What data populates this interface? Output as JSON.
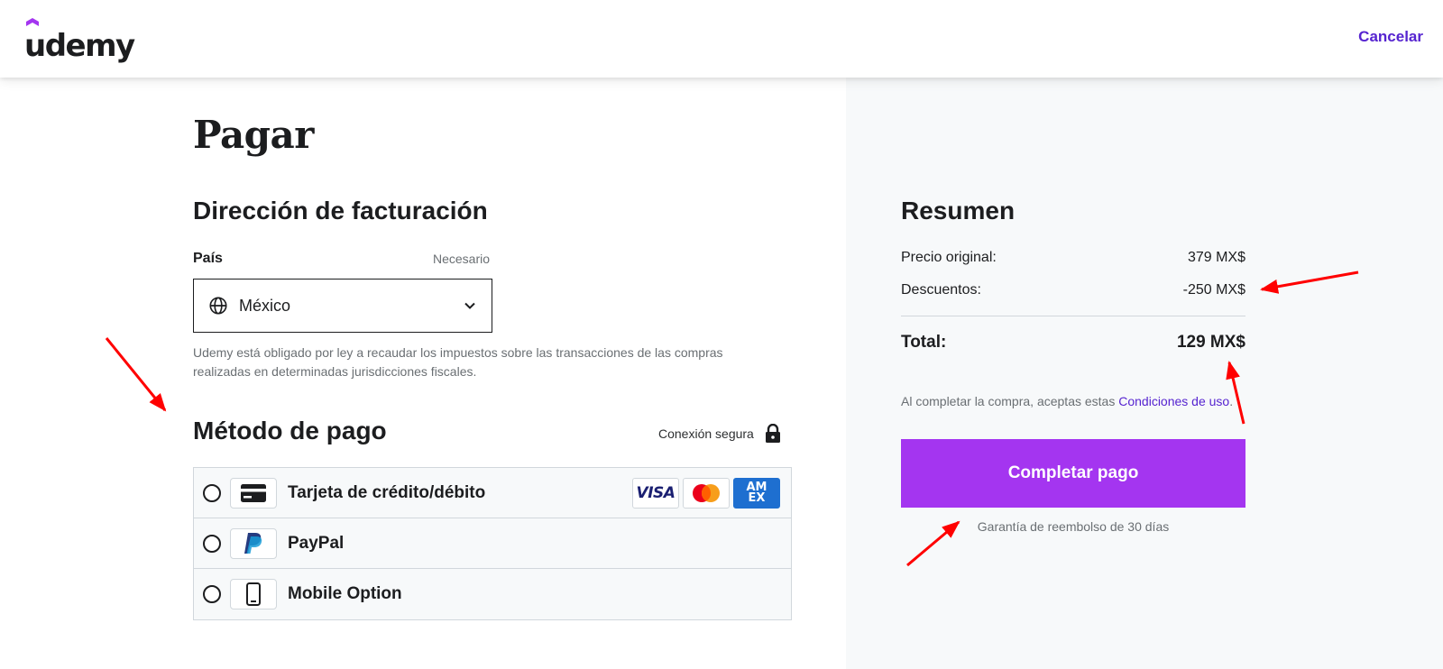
{
  "header": {
    "logo_text": "udemy",
    "cancel_label": "Cancelar"
  },
  "checkout": {
    "title": "Pagar"
  },
  "billing": {
    "title": "Dirección de facturación",
    "country_label": "País",
    "required_label": "Necesario",
    "country_value": "México",
    "tax_note": "Udemy está obligado por ley a recaudar los impuestos sobre las transacciones de las compras realizadas en determinadas jurisdicciones fiscales."
  },
  "payment": {
    "title": "Método de pago",
    "secure_label": "Conexión segura",
    "methods": [
      {
        "label": "Tarjeta de crédito/débito",
        "icon": "credit-card-icon"
      },
      {
        "label": "PayPal",
        "icon": "paypal-icon"
      },
      {
        "label": "Mobile Option",
        "icon": "mobile-phone-icon"
      }
    ],
    "card_brands": [
      "VISA",
      "Mastercard",
      "AMEX"
    ]
  },
  "summary": {
    "title": "Resumen",
    "original_label": "Precio original:",
    "original_value": "379 MX$",
    "discount_label": "Descuentos:",
    "discount_value": "-250 MX$",
    "total_label": "Total:",
    "total_value": "129 MX$",
    "terms_prefix": "Al completar la compra, aceptas estas ",
    "terms_link": "Condiciones de uso",
    "terms_suffix": ".",
    "pay_button": "Completar pago",
    "guarantee": "Garantía de reembolso de 30 días"
  },
  "colors": {
    "brand_purple": "#a435f0",
    "link_purple": "#5624d0",
    "annotation_red": "#ff0000",
    "panel_bg": "#f7f9fa"
  }
}
